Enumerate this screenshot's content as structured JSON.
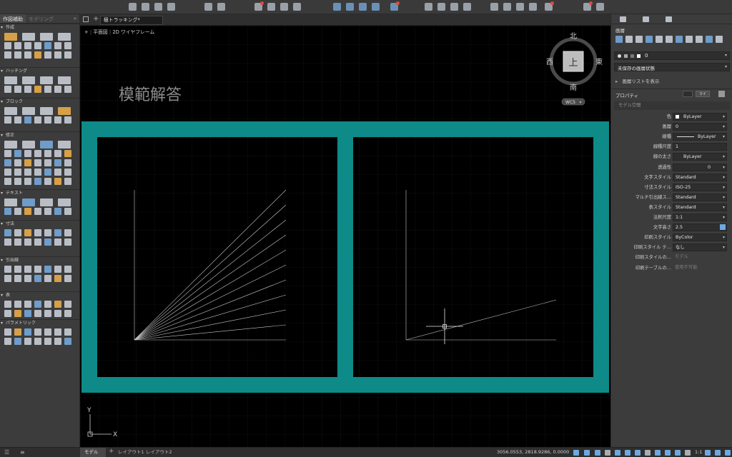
{
  "left_panel": {
    "tabs": [
      "作図補助",
      "モデリング"
    ],
    "sections": [
      "作成",
      "ハッチング",
      "ブロック",
      "修正",
      "テキスト",
      "寸法",
      "引出線",
      "表",
      "パラメトリック"
    ]
  },
  "doc_tab": {
    "title": "極トラッキング*"
  },
  "viewport": {
    "controls": [
      "+",
      "平面図",
      "2D ワイヤフレーム"
    ]
  },
  "canvas": {
    "title_text": "模範解答",
    "frame_color": "#0e8a88"
  },
  "viewcube": {
    "north": "北",
    "south": "南",
    "east": "東",
    "west": "西",
    "face": "上",
    "wcs": "WCS"
  },
  "ucs": {
    "x": "X",
    "y": "Y"
  },
  "right_panel": {
    "tabs": [
      "画層",
      "プロパティ"
    ],
    "layers_title": "画層",
    "layer_current": "0",
    "layer_state": "未保存の画層状態",
    "layer_list_link": "画層リストを表示",
    "properties_title": "プロパティ",
    "prop_filter": "モデル空間",
    "props": [
      {
        "label": "色",
        "value": "ByLayer",
        "dd": true
      },
      {
        "label": "画層",
        "value": "0",
        "dd": true
      },
      {
        "label": "線種",
        "value": "ByLayer",
        "dd": true
      },
      {
        "label": "線種尺度",
        "value": "1",
        "dd": false
      },
      {
        "label": "線の太さ",
        "value": "ByLayer",
        "dd": true
      },
      {
        "label": "透過性",
        "value": "0",
        "dd": true
      },
      {
        "label": "文字スタイル",
        "value": "Standard",
        "dd": true
      },
      {
        "label": "寸法スタイル",
        "value": "ISO-25",
        "dd": true
      },
      {
        "label": "マルチ引出線ス…",
        "value": "Standard",
        "dd": true
      },
      {
        "label": "表スタイル",
        "value": "Standard",
        "dd": true
      },
      {
        "label": "注釈尺度",
        "value": "1:1",
        "dd": true
      },
      {
        "label": "文字高さ",
        "value": "2.5",
        "dd": false
      },
      {
        "label": "印刷スタイル",
        "value": "ByColor",
        "dd": true
      },
      {
        "label": "印刷スタイル テ…",
        "value": "なし",
        "dd": true
      },
      {
        "label": "印刷スタイルの…",
        "value": "モデル",
        "dd": false,
        "dim": true
      },
      {
        "label": "印刷テーブルの…",
        "value": "使用不可能",
        "dd": false,
        "dim": true
      }
    ]
  },
  "status_bar": {
    "tabs": [
      "モデル",
      "レイアウト1",
      "レイアウト2"
    ],
    "coords": "3056.0553, 2818.9286, 0.0000",
    "scale": "1:1"
  }
}
